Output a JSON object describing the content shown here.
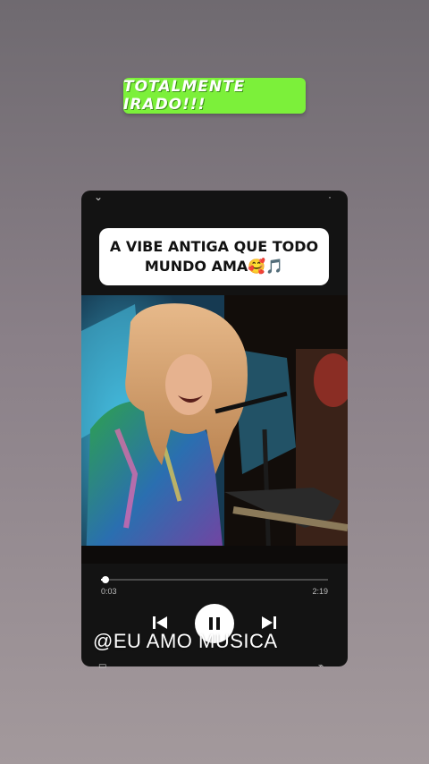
{
  "top_sticker": {
    "text": "TOTALMENTE IRADO!!!"
  },
  "card": {
    "caption": "A VIBE ANTIGA QUE TODO MUNDO AMA🥰🎵",
    "player": {
      "elapsed": "0:03",
      "duration": "2:19",
      "progress_fraction": 0.02
    },
    "icons": {
      "collapse": "chevron-down-icon",
      "more": "more-icon",
      "previous": "skip-previous-icon",
      "pause": "pause-icon",
      "next": "skip-next-icon",
      "save": "save-icon",
      "share": "share-icon"
    }
  },
  "watermark": {
    "text": "@EU AMO MUSICA"
  },
  "colors": {
    "sticker_bg": "#7cf03a",
    "card_bg": "#131313"
  }
}
